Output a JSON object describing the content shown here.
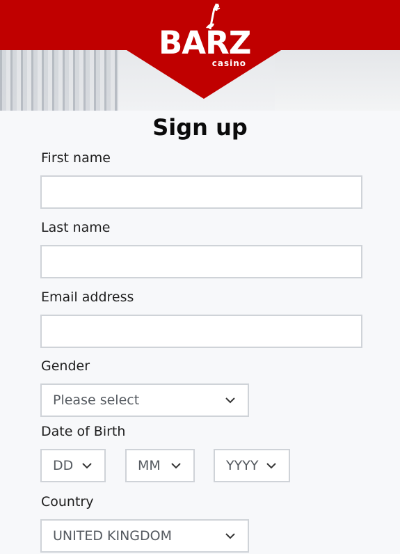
{
  "brand": {
    "logo_text": "BARZ",
    "logo_subtext": "casino"
  },
  "page": {
    "title": "Sign up"
  },
  "form": {
    "first_name": {
      "label": "First name",
      "value": ""
    },
    "last_name": {
      "label": "Last name",
      "value": ""
    },
    "email": {
      "label": "Email address",
      "value": ""
    },
    "gender": {
      "label": "Gender",
      "selected": "Please select"
    },
    "dob": {
      "label": "Date of Birth",
      "day": "DD",
      "month": "MM",
      "year": "YYYY"
    },
    "country": {
      "label": "Country",
      "selected": "UNITED KINGDOM"
    }
  },
  "icons": {
    "dropdown": "chevron-down-icon",
    "logo": "guitar-icon"
  },
  "colors": {
    "brand_red": "#c00000",
    "page_bg": "#f7f8fa",
    "field_border": "#cfd3d8"
  }
}
